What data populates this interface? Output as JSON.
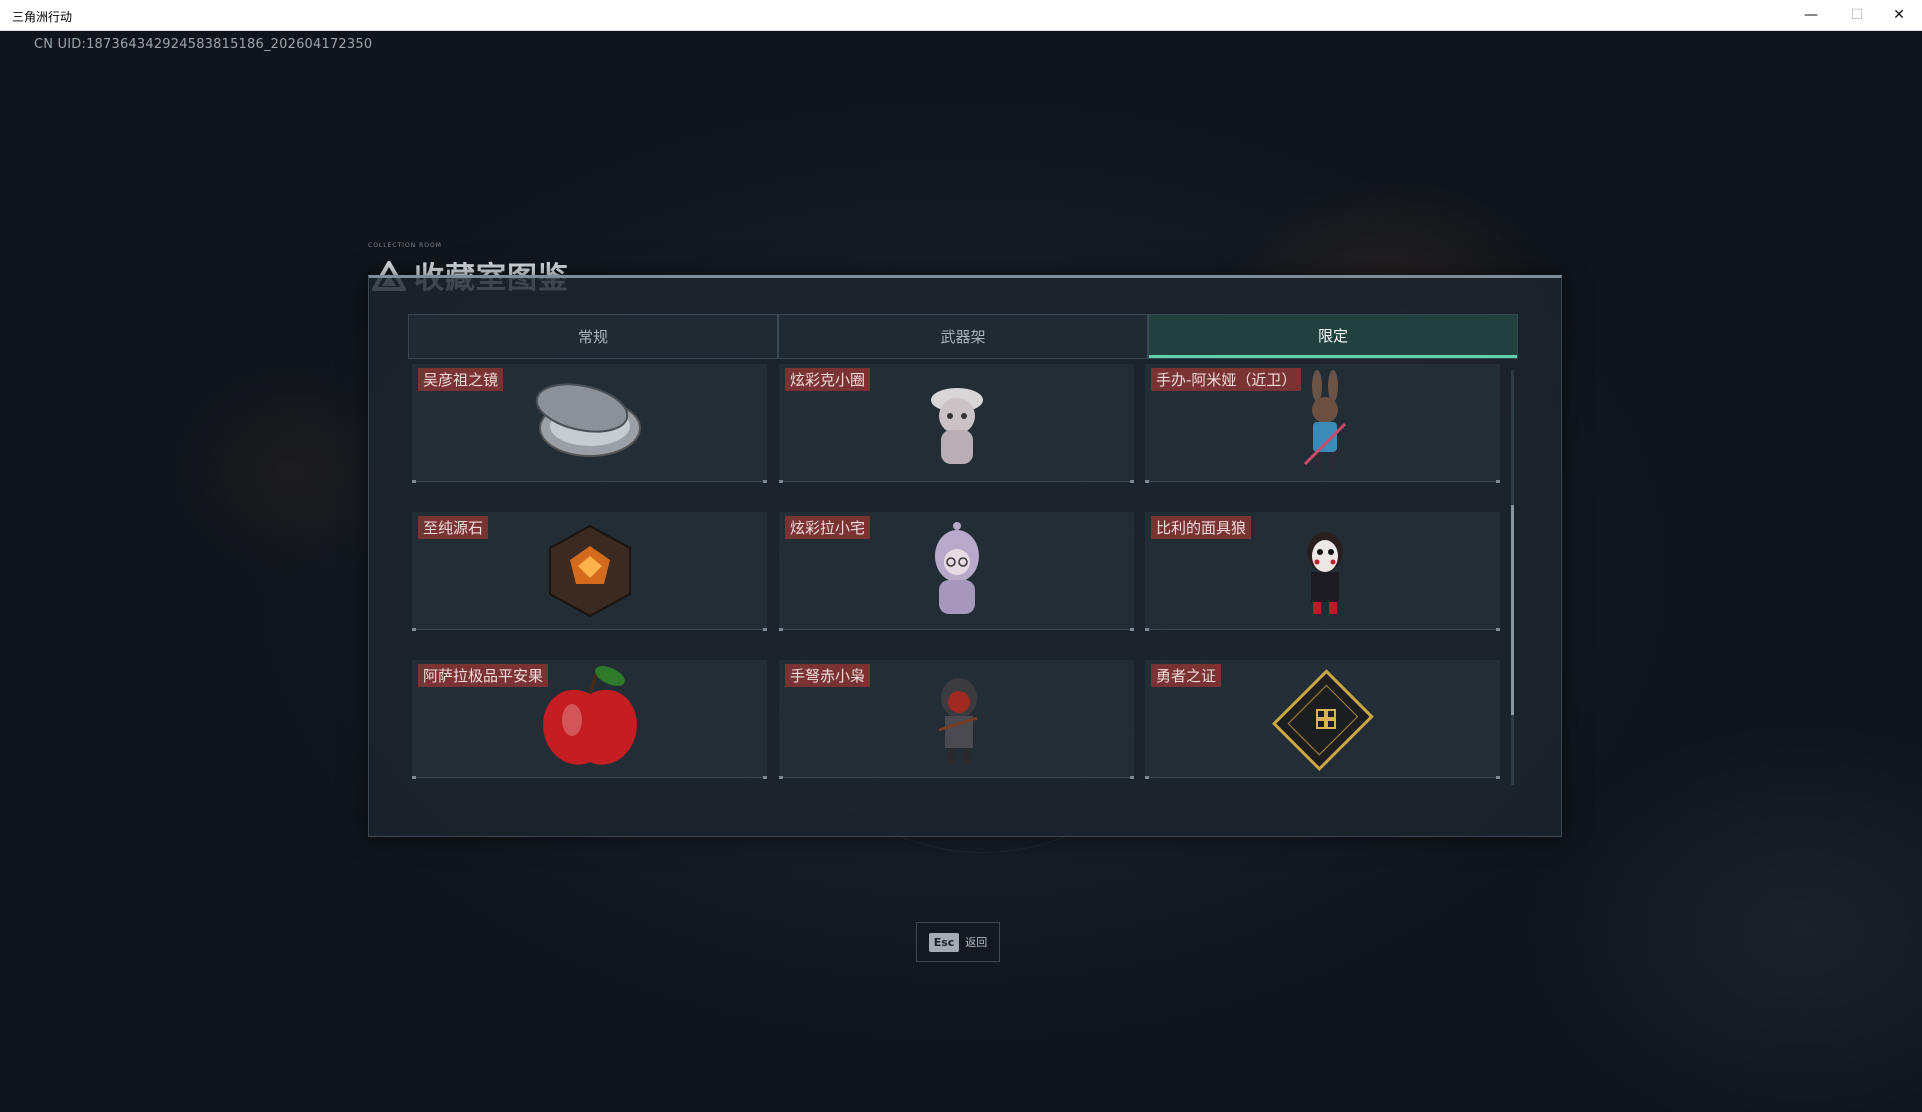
{
  "window": {
    "title": "三角洲行动",
    "controls": {
      "minimize": "—",
      "maximize": "☐",
      "close": "✕"
    }
  },
  "uid_text": "CN UID:18736434292458381518​6_202604172350",
  "panel": {
    "title": "收藏室图鉴",
    "caption": "COLLECTION ROOM"
  },
  "tabs": [
    {
      "label": "常规",
      "active": false
    },
    {
      "label": "武器架",
      "active": false
    },
    {
      "label": "限定",
      "active": true
    }
  ],
  "items": [
    {
      "name": "吴彦祖之镜",
      "icon": "compact-mirror-icon"
    },
    {
      "name": "炫彩克小圈",
      "icon": "plush-figure-icon"
    },
    {
      "name": "手办-阿米娅（近卫）",
      "icon": "rabbit-girl-figure-icon"
    },
    {
      "name": "至纯源石",
      "icon": "originium-crystal-icon"
    },
    {
      "name": "炫彩拉小宅",
      "icon": "hooded-figure-icon"
    },
    {
      "name": "比利的面具狼",
      "icon": "puppet-mask-figure-icon"
    },
    {
      "name": "阿萨拉极品平安果",
      "icon": "red-apple-icon"
    },
    {
      "name": "手弩赤小枭",
      "icon": "crossbow-hood-figure-icon"
    },
    {
      "name": "勇者之证",
      "icon": "gold-card-icon"
    }
  ],
  "footer": {
    "key": "Esc",
    "label": "返回"
  },
  "colors": {
    "accent": "#5fcfae",
    "label_bg": "#7a3333"
  }
}
